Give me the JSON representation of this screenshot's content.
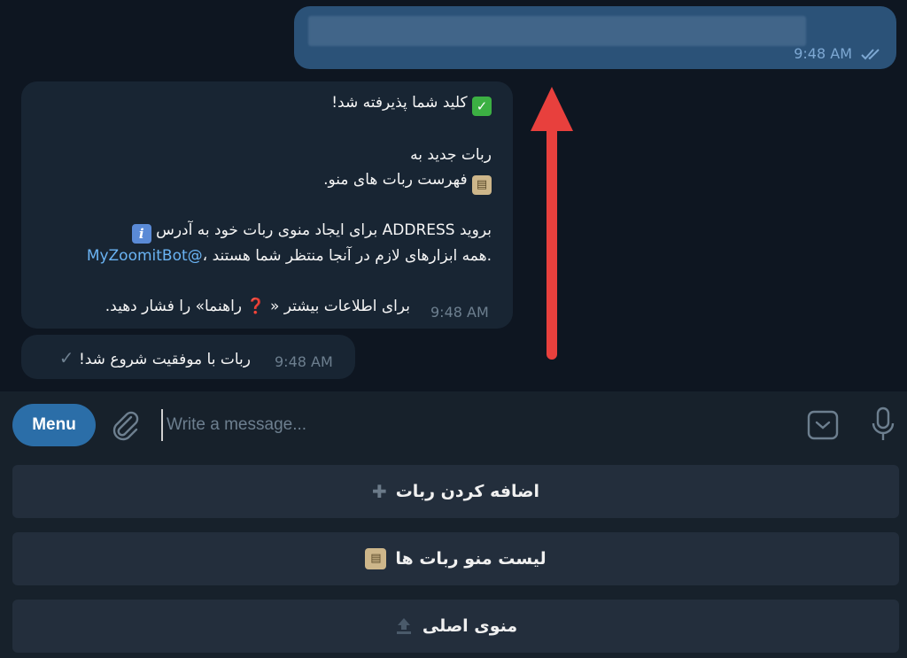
{
  "outgoing": {
    "time": "9:48 AM",
    "status_icon": "double-check-icon"
  },
  "incoming_main": {
    "line1": "کلید شما پذیرفته شد!",
    "line2": "ربات جدید به",
    "line3": "فهرست ربات های منو.",
    "line4": "بروید ADDRESS برای ایجاد منوی ربات خود به آدرس",
    "line5": ".همه ابزارهای لازم در آنجا منتظر شما هستند ،",
    "mention": "@MyZoomitBot",
    "line6": "برای اطلاعات بیشتر « ❓ راهنما» را فشار دهید.",
    "time": "9:48 AM"
  },
  "incoming_small": {
    "text": "ربات با موفقیت شروع شد!",
    "time": "9:48 AM"
  },
  "input_bar": {
    "menu_label": "Menu",
    "placeholder": "Write a message..."
  },
  "keyboard": {
    "buttons": [
      {
        "label": "اضافه کردن ربات",
        "icon": "plus-icon"
      },
      {
        "label": "لیست منو ربات ها",
        "icon": "clipboard-icon"
      },
      {
        "label": "منوی اصلی",
        "icon": "upload-icon"
      }
    ]
  },
  "colors": {
    "background": "#0e1621",
    "outgoing_bubble": "#2b5278",
    "incoming_bubble": "#182533",
    "link": "#6ab3f3",
    "menu_button": "#2b6ea8",
    "annotation_arrow": "#e8403d"
  }
}
